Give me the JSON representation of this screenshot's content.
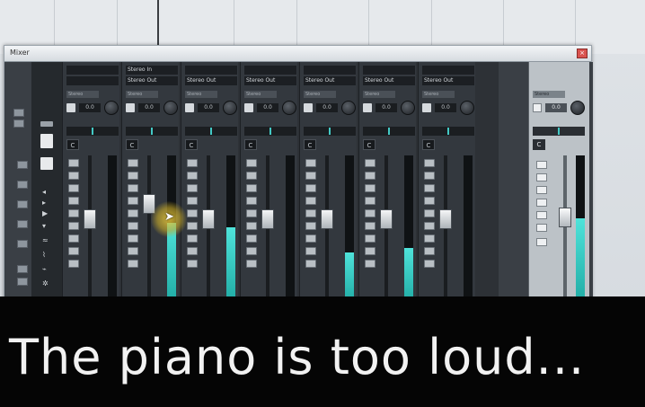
{
  "window": {
    "title": "Mixer",
    "close_glyph": "×"
  },
  "channels": [
    {
      "route_in": "",
      "route_out": "",
      "dropdown": "Stereo",
      "value": "0.0",
      "pan_badge": "C",
      "fader_pos": 0.42,
      "meter_level": 0.0
    },
    {
      "route_in": "Stereo In",
      "route_out": "Stereo Out",
      "dropdown": "Stereo",
      "value": "0.0",
      "pan_badge": "C",
      "fader_pos": 0.3,
      "meter_level": 0.55
    },
    {
      "route_in": "",
      "route_out": "Stereo Out",
      "dropdown": "Stereo",
      "value": "0.0",
      "pan_badge": "C",
      "fader_pos": 0.42,
      "meter_level": 0.52
    },
    {
      "route_in": "",
      "route_out": "Stereo Out",
      "dropdown": "Stereo",
      "value": "0.0",
      "pan_badge": "C",
      "fader_pos": 0.42,
      "meter_level": 0.0
    },
    {
      "route_in": "",
      "route_out": "Stereo Out",
      "dropdown": "Stereo",
      "value": "0.0",
      "pan_badge": "C",
      "fader_pos": 0.42,
      "meter_level": 0.35
    },
    {
      "route_in": "",
      "route_out": "Stereo Out",
      "dropdown": "Stereo",
      "value": "0.0",
      "pan_badge": "C",
      "fader_pos": 0.42,
      "meter_level": 0.38
    },
    {
      "route_in": "",
      "route_out": "Stereo Out",
      "dropdown": "Stereo",
      "value": "0.0",
      "pan_badge": "C",
      "fader_pos": 0.42,
      "meter_level": 0.0
    }
  ],
  "master": {
    "dropdown": "Stereo",
    "value": "0.0",
    "pan_badge": "C",
    "fader_pos": 0.4,
    "meter_level": 0.58
  },
  "caption": {
    "text": "The piano is too loud..."
  },
  "colors": {
    "meter": "#2fc4bc",
    "window_bg": "#2d3136",
    "caption_bg": "#050505",
    "cursor_highlight": "#e2c43a"
  }
}
